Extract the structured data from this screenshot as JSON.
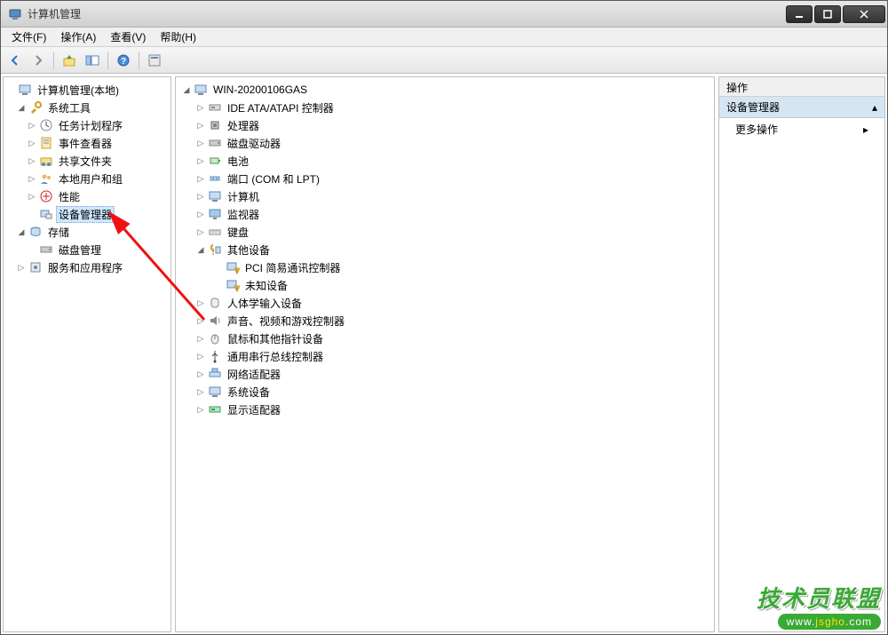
{
  "window": {
    "title": "计算机管理"
  },
  "menu": {
    "file": "文件(F)",
    "action": "操作(A)",
    "view": "查看(V)",
    "help": "帮助(H)"
  },
  "leftTree": {
    "root": "计算机管理(本地)",
    "systemTools": "系统工具",
    "taskScheduler": "任务计划程序",
    "eventViewer": "事件查看器",
    "sharedFolders": "共享文件夹",
    "localUsers": "本地用户和组",
    "performance": "性能",
    "deviceManager": "设备管理器",
    "storage": "存储",
    "diskManagement": "磁盘管理",
    "services": "服务和应用程序"
  },
  "centerTree": {
    "host": "WIN-20200106GAS",
    "ide": "IDE ATA/ATAPI 控制器",
    "cpu": "处理器",
    "diskDrives": "磁盘驱动器",
    "battery": "电池",
    "ports": "端口 (COM 和 LPT)",
    "computer": "计算机",
    "monitor": "监视器",
    "keyboard": "键盘",
    "otherDevices": "其他设备",
    "pciComm": "PCI 简易通讯控制器",
    "unknown": "未知设备",
    "hid": "人体学输入设备",
    "sound": "声音、视频和游戏控制器",
    "mouse": "鼠标和其他指针设备",
    "usb": "通用串行总线控制器",
    "network": "网络适配器",
    "system": "系统设备",
    "display": "显示适配器"
  },
  "rightPanel": {
    "header": "操作",
    "section": "设备管理器",
    "more": "更多操作"
  },
  "watermark": {
    "text": "技术员联盟",
    "urlPrefix": "www.",
    "urlMid": "jsgho",
    "urlSuffix": ".com"
  }
}
